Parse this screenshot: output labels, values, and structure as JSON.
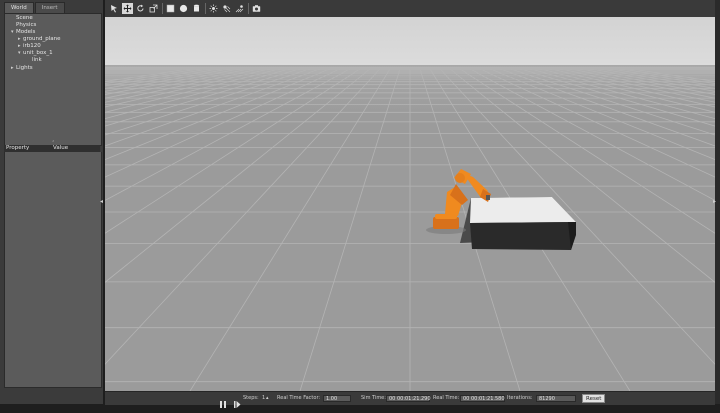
{
  "left_panel": {
    "tabs": [
      {
        "label": "World"
      },
      {
        "label": "Insert"
      }
    ],
    "tree": [
      {
        "label": "Scene"
      },
      {
        "label": "Physics"
      },
      {
        "label": "Models"
      },
      {
        "label": "ground_plane"
      },
      {
        "label": "irb120"
      },
      {
        "label": "unit_box_1"
      },
      {
        "label": "link"
      },
      {
        "label": "Lights"
      }
    ],
    "props_header": {
      "property": "Property",
      "value": "Value"
    }
  },
  "toolbar": {
    "tools": [
      "select-icon",
      "translate-icon",
      "rotate-icon",
      "scale-icon",
      "box-icon",
      "sphere-icon",
      "cylinder-icon",
      "point-light-icon",
      "spot-light-icon",
      "directional-light-icon",
      "screenshot-icon"
    ]
  },
  "bottom_bar": {
    "pause_icon": "pause-icon",
    "step_icon": "step-icon",
    "steps_label": "Steps:",
    "steps_value": "1",
    "rtf_label": "Real Time Factor:",
    "rtf_value": "1.00",
    "sim_time_label": "Sim Time:",
    "sim_time_value": "00 00:01:21.290",
    "real_time_label": "Real Time:",
    "real_time_value": "00 00:01:21.580",
    "iterations_label": "Iterations:",
    "iterations_value": "81290",
    "reset_label": "Reset"
  },
  "colors": {
    "panel_bg": "#3b3b3b",
    "tree_bg": "#5b5b5b",
    "sky": "#d9d9d9",
    "ground": "#9b9b9b",
    "robot": "#f08a1f"
  }
}
